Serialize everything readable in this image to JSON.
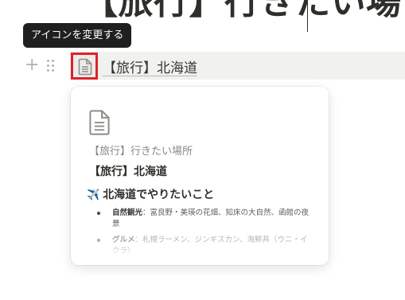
{
  "page": {
    "title": "【旅行】行きたい場"
  },
  "tooltip": {
    "text": "アイコンを変更する"
  },
  "block": {
    "add_symbol": "+",
    "icon": "page-document-icon",
    "title": "【旅行】北海道"
  },
  "preview": {
    "icon": "page-document-icon",
    "breadcrumb": "【旅行】行きたい場所",
    "title": "【旅行】北海道",
    "heading_emoji": "✈️",
    "heading_text": "北海道でやりたいこと",
    "bullets": [
      {
        "term": "自然観光",
        "text": "：富良野・美瑛の花畑、知床の大自然、函館の夜景"
      },
      {
        "term": "グルメ",
        "text": "：札幌ラーメン、ジンギスカン、海鮮丼（ウニ・イクラ）"
      }
    ]
  },
  "colors": {
    "highlight_border": "#e0212b",
    "tooltip_bg": "#1f1f1f",
    "row_hover_bg": "#f1f1ef"
  }
}
